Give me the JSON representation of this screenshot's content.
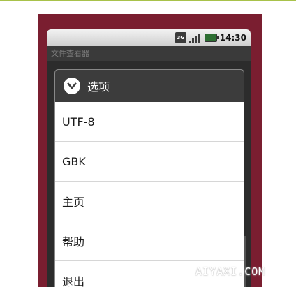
{
  "status_bar": {
    "network": "3G",
    "time": "14:30"
  },
  "app": {
    "title": "文件查看器"
  },
  "dialog": {
    "title": "选项",
    "icon": "chevron-down-circle-icon",
    "items": [
      {
        "label": "UTF-8"
      },
      {
        "label": "GBK"
      },
      {
        "label": "主页"
      },
      {
        "label": "帮助"
      },
      {
        "label": "退出"
      }
    ]
  },
  "watermark": {
    "text": "AIYAXI.COM"
  },
  "colors": {
    "frame": "#7a1e30",
    "dialog_header": "#3c3c3c",
    "accent_line": "#a8c24a"
  }
}
